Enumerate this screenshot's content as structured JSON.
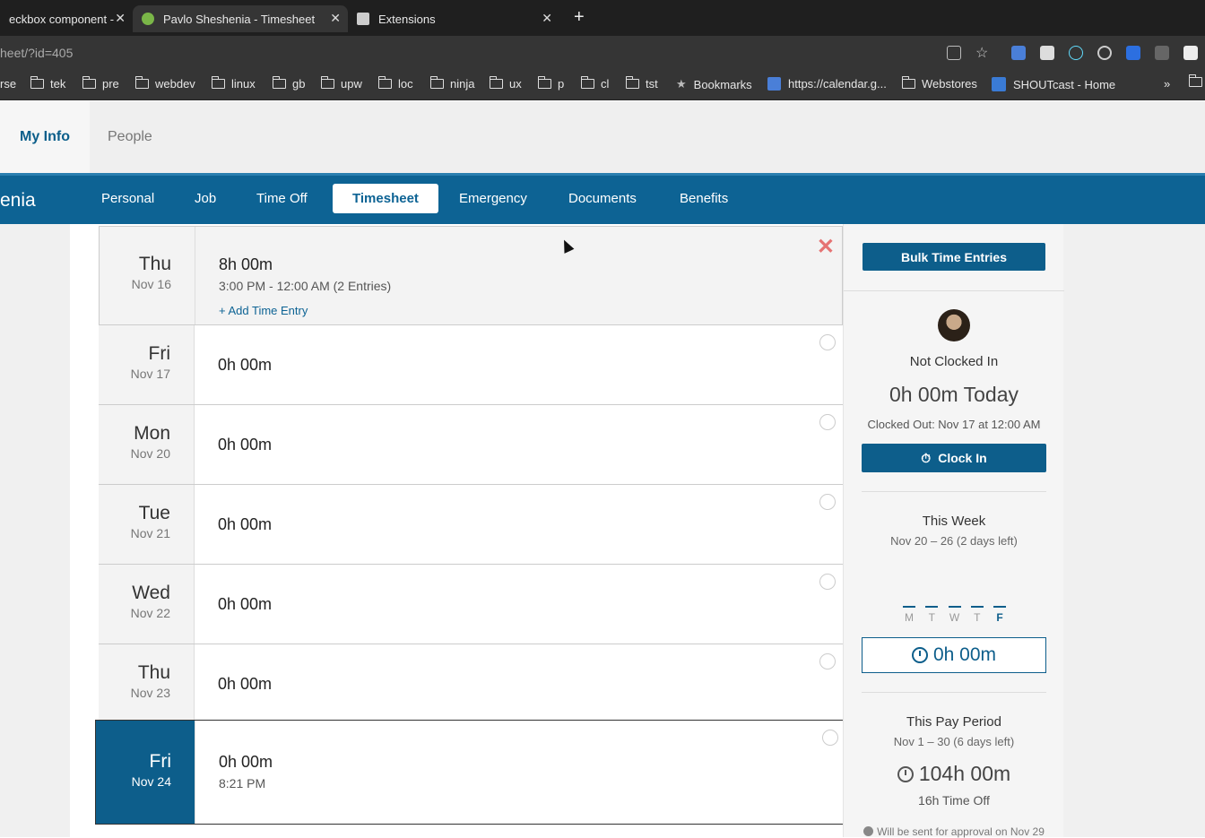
{
  "browser": {
    "tabs": [
      {
        "title": "eckbox component -",
        "active": false
      },
      {
        "title": "Pavlo Sheshenia - Timesheet",
        "active": true
      },
      {
        "title": "Extensions",
        "active": false
      }
    ],
    "url": "heet/?id=405",
    "bookmarks": [
      "rse",
      "tek",
      "pre",
      "webdev",
      "linux",
      "gb",
      "upw",
      "loc",
      "ninja",
      "ux",
      "p",
      "cl",
      "tst",
      "Bookmarks",
      "https://calendar.g...",
      "Webstores",
      "SHOUTcast - Home"
    ],
    "more": "»"
  },
  "topnav": {
    "my_info": "My Info",
    "people": "People"
  },
  "subnav": {
    "name": "enia",
    "tabs": [
      "Personal",
      "Job",
      "Time Off",
      "Timesheet",
      "Emergency",
      "Documents",
      "Benefits"
    ],
    "active": "Timesheet"
  },
  "days": [
    {
      "day": "Thu",
      "date": "Nov 16",
      "hours": "8h 00m",
      "detail": "3:00 PM - 12:00 AM  (2 Entries)",
      "add": "+ Add Time Entry"
    },
    {
      "day": "Fri",
      "date": "Nov 17",
      "hours": "0h 00m"
    },
    {
      "day": "Mon",
      "date": "Nov 20",
      "hours": "0h 00m"
    },
    {
      "day": "Tue",
      "date": "Nov 21",
      "hours": "0h 00m"
    },
    {
      "day": "Wed",
      "date": "Nov 22",
      "hours": "0h 00m"
    },
    {
      "day": "Thu",
      "date": "Nov 23",
      "hours": "0h 00m"
    },
    {
      "day": "Fri",
      "date": "Nov 24",
      "hours": "0h 00m",
      "detail": "8:21 PM"
    }
  ],
  "sidebar": {
    "bulk_button": "Bulk Time Entries",
    "status": "Not Clocked In",
    "today": "0h 00m Today",
    "clocked_out": "Clocked Out: Nov 17 at 12:00 AM",
    "clock_in": "Clock In",
    "week_title": "This Week",
    "week_range": "Nov 20 – 26 (2 days left)",
    "week_days": [
      "M",
      "T",
      "W",
      "T",
      "F"
    ],
    "week_total": "0h 00m",
    "period_title": "This Pay Period",
    "period_range": "Nov 1 – 30 (6 days left)",
    "period_total": "104h 00m",
    "time_off": "16h Time Off",
    "approval": "Will be sent for approval on Nov 29"
  }
}
